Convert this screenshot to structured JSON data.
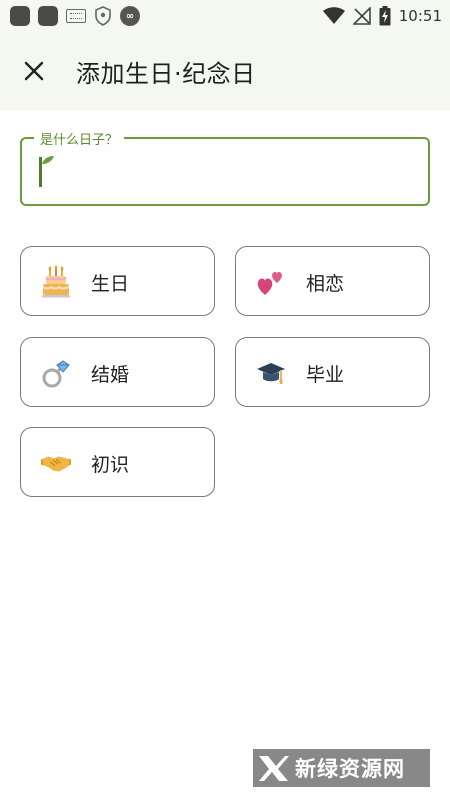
{
  "status_bar": {
    "time": "10:51"
  },
  "app_bar": {
    "title": "添加生日·纪念日"
  },
  "field": {
    "label": "是什么日子？",
    "value": "",
    "placeholder": ""
  },
  "options": [
    {
      "label": "生日",
      "icon": "birthday-cake-icon"
    },
    {
      "label": "相恋",
      "icon": "two-hearts-icon"
    },
    {
      "label": "结婚",
      "icon": "ring-icon"
    },
    {
      "label": "毕业",
      "icon": "graduation-cap-icon"
    },
    {
      "label": "初识",
      "icon": "handshake-icon"
    }
  ],
  "watermark": {
    "text": "新绿资源网"
  },
  "colors": {
    "accent": "#6a9b3c",
    "app_bar_bg": "#f5f8f0",
    "card_border": "#7a7a7a"
  }
}
